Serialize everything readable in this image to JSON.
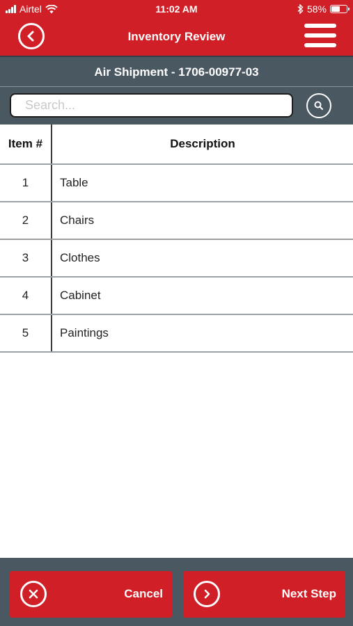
{
  "status_bar": {
    "carrier": "Airtel",
    "time": "11:02 AM",
    "battery": "58%",
    "battery_level": 0.58
  },
  "header": {
    "title": "Inventory Review",
    "back_icon": "chevron-left-circle-icon",
    "menu_icon": "hamburger-menu-icon"
  },
  "subheader": {
    "title": "Air Shipment - 1706-00977-03"
  },
  "search": {
    "placeholder": "Search...",
    "value": "",
    "icon": "search-icon"
  },
  "table": {
    "columns": [
      "Item #",
      "Description"
    ],
    "rows": [
      {
        "item": "1",
        "description": "Table"
      },
      {
        "item": "2",
        "description": "Chairs"
      },
      {
        "item": "3",
        "description": "Clothes"
      },
      {
        "item": "4",
        "description": "Cabinet"
      },
      {
        "item": "5",
        "description": "Paintings"
      }
    ]
  },
  "footer": {
    "cancel_label": "Cancel",
    "cancel_icon": "close-circle-icon",
    "next_label": "Next Step",
    "next_icon": "chevron-right-circle-icon"
  },
  "colors": {
    "brand_red": "#d01f27",
    "slate": "#4a5862"
  }
}
